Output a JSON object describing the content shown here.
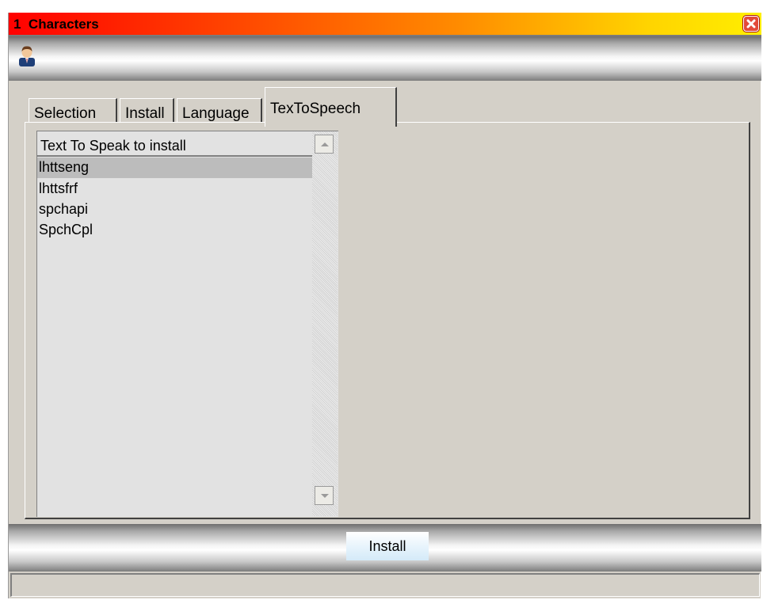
{
  "window": {
    "number": "1",
    "title": "Characters"
  },
  "toolbar": {
    "icon": "user-avatar-icon"
  },
  "tabs": [
    {
      "label": "Selection",
      "active": false
    },
    {
      "label": "Install",
      "active": false
    },
    {
      "label": "Language",
      "active": false
    },
    {
      "label": "TexToSpeech",
      "active": true
    }
  ],
  "list": {
    "header": "Text To Speak to install",
    "items": [
      "lhttseng",
      "lhttsfrf",
      "spchapi",
      "SpchCpl"
    ],
    "selected_index": 0
  },
  "footer": {
    "install_label": "Install"
  },
  "statusbar": {
    "text": ""
  },
  "colors": {
    "title_gradient_start": "#ff0000",
    "title_gradient_end": "#ffef00",
    "panel_bg": "#d4d0c8",
    "list_bg": "#e2e2e2",
    "selected_bg": "#bcbcbc"
  }
}
